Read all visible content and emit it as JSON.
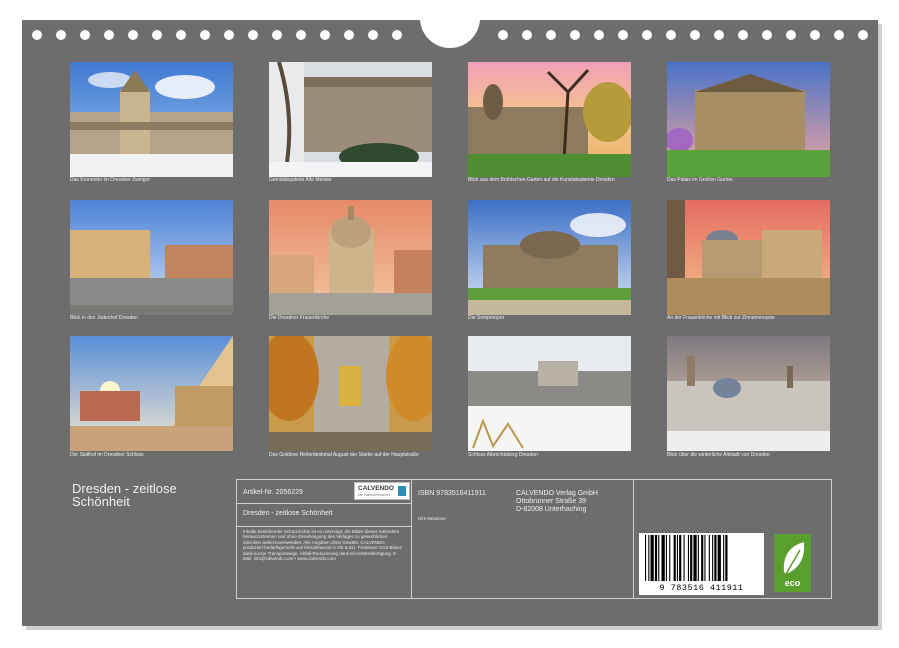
{
  "calendar": {
    "title_line1": "Dresden - zeitlose",
    "title_line2": "Schönheit",
    "photos": [
      {
        "caption": "Das Kronentor im Dresdner Zwinger"
      },
      {
        "caption": "Gemäldegalerie Alte Meister"
      },
      {
        "caption": "Blick aus dem Brühlschen Garten auf die Kunstakademie Dresden"
      },
      {
        "caption": "Das Palais im Großen Garten"
      },
      {
        "caption": "Blick in den Jüdenhof Dresden"
      },
      {
        "caption": "Die Dresdner Frauenkirche"
      },
      {
        "caption": "Die Semperoper"
      },
      {
        "caption": "An der Frauenkirche mit Blick zur Zinnamenasse"
      },
      {
        "caption": "Der Stallhof im Dresdner Schloss"
      },
      {
        "caption": "Das Goldene Reiterdenkmal August der Starke auf der Hauptstraße"
      },
      {
        "caption": "Schloss Albrechtsberg Dresden"
      },
      {
        "caption": "Blick über die winterliche Altstadt von Dresden"
      }
    ]
  },
  "info": {
    "article_label": "Artikel-Nr. 2056229",
    "logo_text": "CALVENDO",
    "logo_sub": "Die Kalendermacher",
    "product_title": "Dresden - zeitlose Schönheit",
    "author": "Dirk Meutzner",
    "isbn": "ISBN 9783516411911",
    "publisher_line1": "CALVENDO Verlag GmbH",
    "publisher_line2": "Ottobrunner Straße 39",
    "publisher_line3": "D-82008 Unterhaching",
    "legal_text": "Inhalte bestehender Schutzrechte ist es untersagt, die Bilder dieses Kalenders herauszutrennen und ohne Genehmigung des Verlages zu gewerblichen Zwecken weiterzuverwenden. Alle Angaben ohne Gewähr. CALVENDO produziert bedarfsgerecht und klimabewusst in DE & EU. Positivere CO2-Bilanz dank kurzer Transportwege. Abfall-Reduzierung dank Einzelstückfertigung. E-Mail: info@calvendo.com • www.calvendo.com",
    "barcode_number": "9 783516 411911",
    "eco_label": "eco"
  },
  "colors": {
    "board": "#6d6d6d",
    "eco_green": "#5a9e2f"
  }
}
